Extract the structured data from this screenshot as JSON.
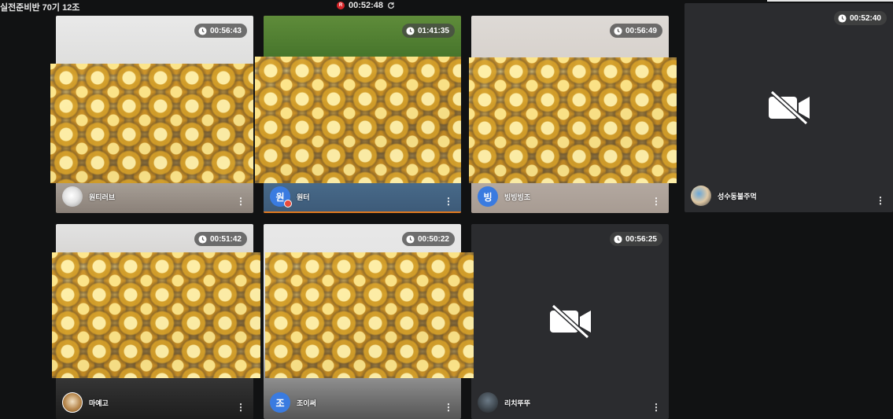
{
  "header": {
    "title": "실전준비반 70기 12조",
    "session_timer": "00:52:48",
    "rec_badge": "R",
    "icons": {
      "record": "record-dot-icon",
      "refresh": "refresh-icon"
    }
  },
  "participants": [
    {
      "name": "원티러브",
      "timer": "00:56:43",
      "camera": "on",
      "avatar": "dog-photo",
      "host": false
    },
    {
      "name": "원터",
      "timer": "01:41:35",
      "camera": "on",
      "avatar_letter": "원",
      "host": true,
      "speaking": true
    },
    {
      "name": "빙빙빙조",
      "timer": "00:56:49",
      "camera": "on",
      "avatar_letter": "빙",
      "host": false
    },
    {
      "name": "성수동불주먹",
      "timer": "00:52:40",
      "camera": "off",
      "avatar": "photo",
      "host": false
    },
    {
      "name": "마예고",
      "timer": "00:51:42",
      "camera": "on",
      "avatar": "monkey",
      "host": false
    },
    {
      "name": "조이써",
      "timer": "00:50:22",
      "camera": "on",
      "avatar_letter": "조",
      "host": false
    },
    {
      "name": "리치뚜뚜",
      "timer": "00:56:25",
      "camera": "off",
      "avatar": "photo",
      "host": false
    }
  ],
  "overlay": {
    "description_icon": "rose-bouquet-image"
  },
  "colors": {
    "background": "#111213",
    "tile_dark": "#2b2c2f",
    "active_border": "#e2336b",
    "accent_orange": "#e07a20",
    "avatar_blue": "#3a7be0"
  }
}
